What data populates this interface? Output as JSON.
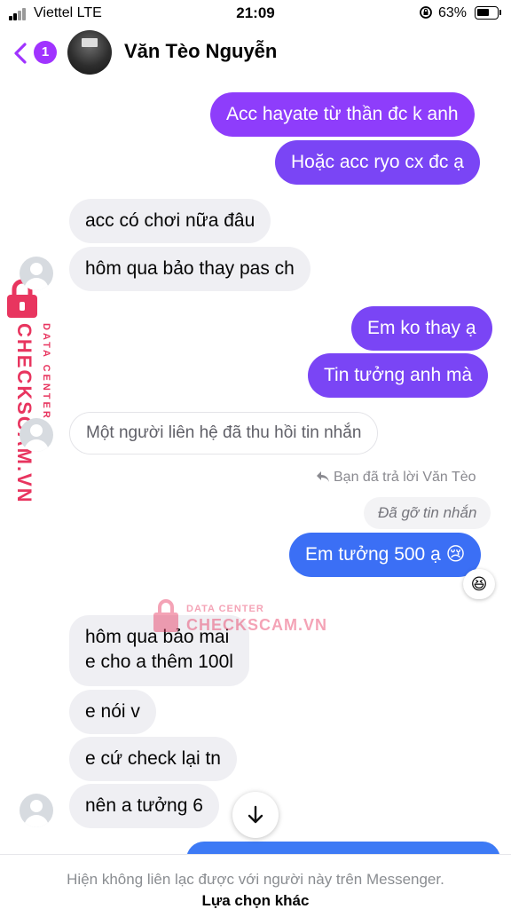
{
  "status_bar": {
    "carrier": "Viettel  LTE",
    "time": "21:09",
    "battery_percent": "63%",
    "battery_level": 0.63
  },
  "header": {
    "back_badge": "1",
    "contact_name": "Văn Tèo Nguyễn"
  },
  "messages": [
    {
      "side": "out",
      "text": "Acc hayate từ thần đc k anh"
    },
    {
      "side": "out",
      "text": "Hoặc acc ryo cx đc ạ"
    },
    {
      "side": "in",
      "text": "acc có chơi nữa đâu"
    },
    {
      "side": "in",
      "text": "hôm qua bảo thay pas ch"
    },
    {
      "side": "out",
      "text": "Em ko thay ạ"
    },
    {
      "side": "out",
      "text": "Tin tưởng anh mà"
    },
    {
      "side": "in",
      "text": "Một người liên hệ đã thu hồi tin nhắn"
    },
    {
      "side": "out",
      "text": "Đã gỡ tin nhắn"
    },
    {
      "side": "out",
      "text": "Em tưởng 500 ạ 😢"
    },
    {
      "side": "in",
      "line1": "hôm qua bảo mai",
      "line2": "e cho a thêm 100l"
    },
    {
      "side": "in",
      "text": "e nói v"
    },
    {
      "side": "in",
      "text": "e cứ check lại tn"
    },
    {
      "side": "in",
      "text": "nên a tưởng 6"
    }
  ],
  "reply_note": "Bạn đã trả lời Văn Tèo",
  "reaction": "😆",
  "footer": {
    "notice": "Hiện không liên lạc được với người này trên Messenger.",
    "other_options": "Lựa chọn khác"
  },
  "watermark": {
    "brand": "CHECKSCAM.VN",
    "sub": "DATA CENTER"
  },
  "icons": {
    "back": "chevron-left-icon",
    "scroll": "arrow-down-icon",
    "reply": "reply-arrow-icon",
    "avatar": "default-avatar-icon"
  },
  "colors": {
    "accent": "#a033ff",
    "outgoing_purple": "#8e3dfb",
    "outgoing_blue": "#3b6ff5",
    "incoming": "#efeff3",
    "watermark": "#e8355f"
  }
}
